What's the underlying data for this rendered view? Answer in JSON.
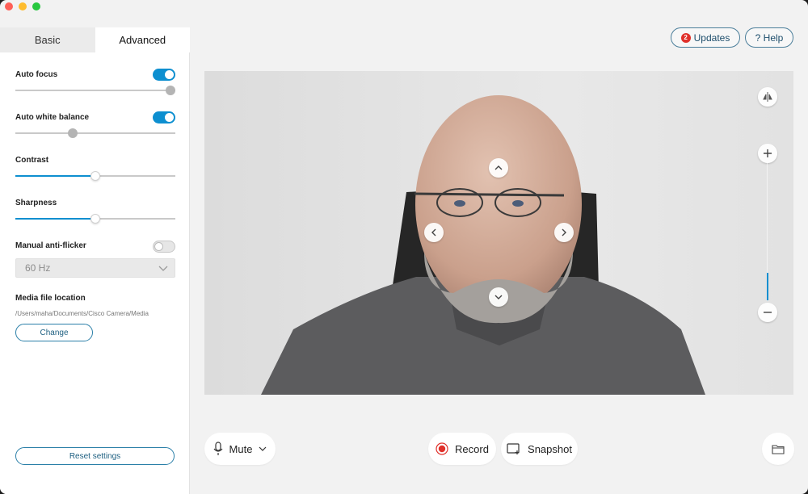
{
  "tabs": {
    "basic": "Basic",
    "advanced": "Advanced"
  },
  "settings": {
    "auto_focus": {
      "label": "Auto focus",
      "enabled": true,
      "value": 1.0
    },
    "auto_white_balance": {
      "label": "Auto white balance",
      "enabled": true,
      "value": 0.36
    },
    "contrast": {
      "label": "Contrast",
      "value": 0.5
    },
    "sharpness": {
      "label": "Sharpness",
      "value": 0.5
    },
    "anti_flicker": {
      "label": "Manual anti-flicker",
      "enabled": false,
      "frequency": "60 Hz"
    },
    "media": {
      "label": "Media file location",
      "path": "/Users/maha/Documents/Cisco Camera/Media",
      "change_label": "Change"
    },
    "reset_label": "Reset settings"
  },
  "header": {
    "updates_label": "Updates",
    "updates_count": "2",
    "help_label": "? Help"
  },
  "camera": {
    "zoom_level": 0.2
  },
  "bottom": {
    "mute_label": "Mute",
    "record_label": "Record",
    "snapshot_label": "Snapshot"
  },
  "colors": {
    "accent": "#0d8fd0",
    "record": "#e0302a",
    "panel": "#ffffff",
    "background": "#f2f2f2"
  },
  "icons": [
    "mic-icon",
    "chevron-down-icon",
    "record-icon",
    "snapshot-icon",
    "folder-icon",
    "flip-icon",
    "zoom-in-icon",
    "zoom-out-icon",
    "pan-up-icon",
    "pan-down-icon",
    "pan-left-icon",
    "pan-right-icon"
  ]
}
